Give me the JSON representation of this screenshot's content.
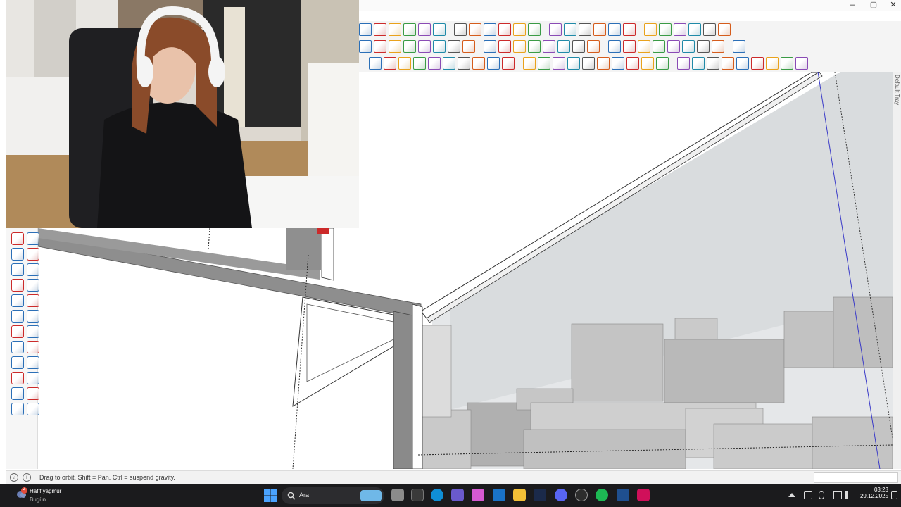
{
  "app": {
    "window_controls": {
      "minimize": "–",
      "maximize": "▢",
      "close": "✕"
    }
  },
  "tray": {
    "label": "Default Tray"
  },
  "statusbar": {
    "hint": "Drag to orbit. Shift = Pan. Ctrl = suspend gravity.",
    "info_icon": "?",
    "geo_icon": "i",
    "measurements_value": ""
  },
  "taskbar": {
    "weather_title": "Hafif yağmur",
    "weather_sub": "Bugün",
    "weather_badge": "4",
    "search_placeholder": "Ara",
    "time": "03:23",
    "date": "29.12.2025"
  },
  "colors": {
    "accent_red": "#cc2a2a",
    "accent_blue": "#2b6fb7",
    "taskbar": "#1b1b1d",
    "wall_gray": "#8e8e8e",
    "sky": "#e3e6e8"
  },
  "icons": {
    "toolbar_row1": [
      "select-icon",
      "eraser-icon",
      "paint-icon",
      "new-file-icon",
      "user-icon",
      "layer-icon",
      "component-icon",
      "tag-icon",
      "push-pull-icon",
      "follow-me-icon",
      "offset-icon",
      "scale-icon",
      "copy-icon",
      "group-icon",
      "ungroup-icon",
      "outliner-icon",
      "styles-icon",
      "iso-view-icon",
      "top-view-icon",
      "front-view-icon",
      "right-view-icon",
      "back-view-icon",
      "left-view-icon",
      "bottom-view-icon"
    ],
    "toolbar_row2": [
      "warning-icon",
      "rotate-icon",
      "sandbox-icon",
      "smoove-icon",
      "move-icon",
      "box-icon",
      "arc-icon",
      "section-icon",
      "solid-icon",
      "intersect-icon",
      "union-icon",
      "subtract-icon",
      "trim-icon",
      "split-icon",
      "grid-icon",
      "texture-icon",
      "tile-icon",
      "x-icon",
      "circle-icon",
      "snap-icon",
      "mirror-icon",
      "axis-icon",
      "tape-icon",
      "protractor-icon",
      "dimension-icon"
    ],
    "toolbar_row3": [
      "bezier-icon",
      "freehand-icon",
      "spline-icon",
      "polyline-icon",
      "curve-icon",
      "rectangle-icon",
      "circle-tool-icon",
      "arc-tool-icon",
      "line-tool-icon",
      "hook-icon",
      "corner-icon",
      "wave-icon",
      "polygon-icon",
      "wrench-icon",
      "oval-icon",
      "cone-icon",
      "flatten-icon",
      "extrude-icon",
      "fillet-icon",
      "chamfer-icon",
      "shell-icon",
      "weld-icon",
      "loft-icon",
      "sweep-icon",
      "cap-icon",
      "skin-icon",
      "bridge-icon",
      "face-icon",
      "join-icon"
    ],
    "left_toolbar": [
      "select-tool-icon",
      "rotate-tool-icon",
      "scale-tool-icon",
      "section-tool-icon",
      "paint-bucket-icon",
      "move-tool-icon",
      "pencil-icon",
      "text-icon",
      "orbit-icon",
      "dimension-text-icon",
      "walk-icon",
      "look-around-icon",
      "zoom-icon",
      "zoom-window-icon",
      "zoom-extents-icon",
      "previous-view-icon",
      "position-camera-icon",
      "walk-tool-icon",
      "eye-icon",
      "section-plane-icon",
      "warehouse-icon",
      "extension-icon",
      "layers-icon",
      "sandbox-tool-icon"
    ]
  }
}
